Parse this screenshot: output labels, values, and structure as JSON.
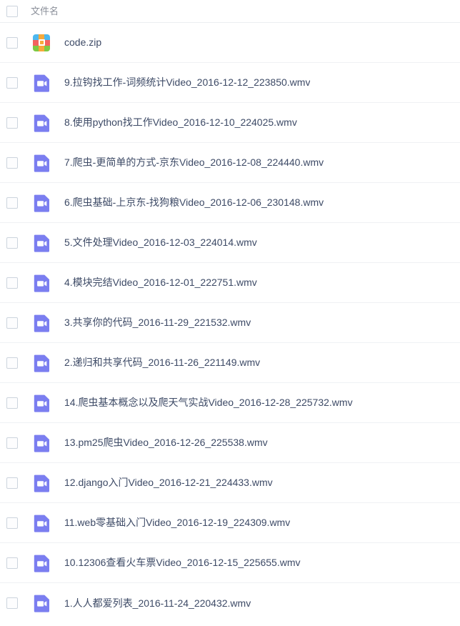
{
  "header": {
    "select_all_checkbox": "select-all",
    "column_label": "文件名"
  },
  "icons": {
    "zip": "zip-archive-icon",
    "video": "video-file-icon",
    "checkbox": "checkbox-icon"
  },
  "colors": {
    "text": "#3d4a66",
    "header_text": "#8a8f99",
    "divider": "#eff1f4",
    "checkbox_border": "#ccd4dd",
    "video_icon": "#7b7ef0",
    "zip_blue": "#4db8ef",
    "zip_orange": "#f7a93b",
    "zip_red": "#f3625f",
    "zip_green": "#7ec944",
    "background": "#ffffff"
  },
  "files": [
    {
      "name": "code.zip",
      "type": "zip"
    },
    {
      "name": "9.拉钩找工作-词频统计Video_2016-12-12_223850.wmv",
      "type": "video"
    },
    {
      "name": "8.使用python找工作Video_2016-12-10_224025.wmv",
      "type": "video"
    },
    {
      "name": "7.爬虫-更简单的方式-京东Video_2016-12-08_224440.wmv",
      "type": "video"
    },
    {
      "name": "6.爬虫基础-上京东-找狗粮Video_2016-12-06_230148.wmv",
      "type": "video"
    },
    {
      "name": "5.文件处理Video_2016-12-03_224014.wmv",
      "type": "video"
    },
    {
      "name": "4.模块完结Video_2016-12-01_222751.wmv",
      "type": "video"
    },
    {
      "name": "3.共享你的代码_2016-11-29_221532.wmv",
      "type": "video"
    },
    {
      "name": "2.递归和共享代码_2016-11-26_221149.wmv",
      "type": "video"
    },
    {
      "name": "14.爬虫基本概念以及爬天气实战Video_2016-12-28_225732.wmv",
      "type": "video"
    },
    {
      "name": "13.pm25爬虫Video_2016-12-26_225538.wmv",
      "type": "video"
    },
    {
      "name": "12.django入门Video_2016-12-21_224433.wmv",
      "type": "video"
    },
    {
      "name": "11.web零基础入门Video_2016-12-19_224309.wmv",
      "type": "video"
    },
    {
      "name": "10.12306查看火车票Video_2016-12-15_225655.wmv",
      "type": "video"
    },
    {
      "name": "1.人人都爱列表_2016-11-24_220432.wmv",
      "type": "video"
    }
  ]
}
